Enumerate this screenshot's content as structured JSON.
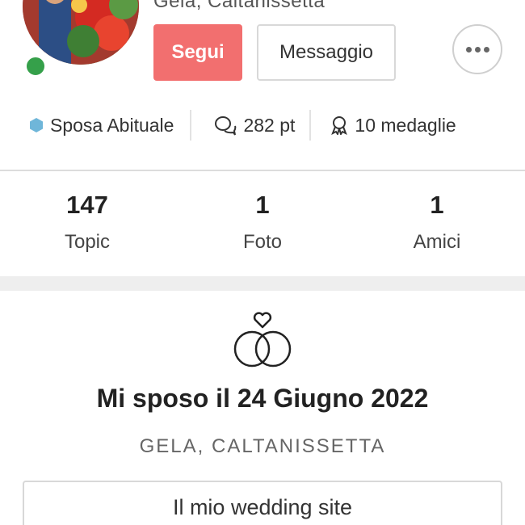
{
  "profile": {
    "location_top": "Gela, Caltanissetta",
    "follow_label": "Segui",
    "message_label": "Messaggio",
    "status": "online"
  },
  "badges": {
    "level_label": "Sposa Abituale",
    "points_label": "282 pt",
    "medals_label": "10 medaglie"
  },
  "stats": [
    {
      "value": "147",
      "label": "Topic"
    },
    {
      "value": "1",
      "label": "Foto"
    },
    {
      "value": "1",
      "label": "Amici"
    }
  ],
  "wedding": {
    "title": "Mi sposo il 24 Giugno 2022",
    "location": "GELA, CALTANISSETTA",
    "site_button": "Il mio wedding site"
  },
  "colors": {
    "accent": "#f26f6f",
    "online": "#35a04a",
    "badge_hex": "#6fb6d9"
  }
}
